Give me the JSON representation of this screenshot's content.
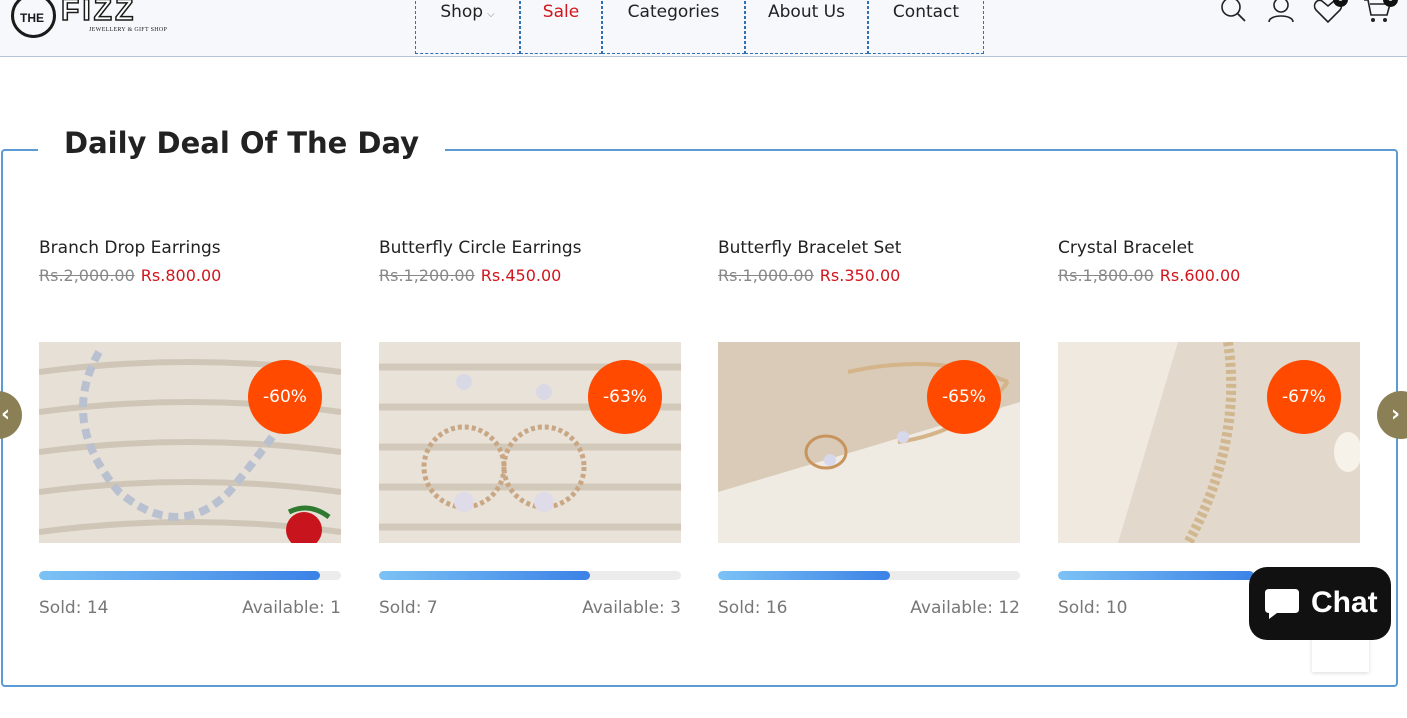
{
  "brand": {
    "logo_prefix": "THE",
    "logo_name": "FIZZ",
    "tagline": "JEWELLERY & GIFT SHOP"
  },
  "nav": {
    "shop": "Shop",
    "sale": "Sale",
    "categories": "Categories",
    "about": "About Us",
    "contact": "Contact"
  },
  "header_icons": [
    "search-icon",
    "account-icon",
    "wishlist-icon",
    "cart-icon"
  ],
  "badges": {
    "wishlist": "0",
    "cart": "0"
  },
  "section": {
    "title": "Daily Deal Of The Day"
  },
  "products": [
    {
      "name": "Branch Drop Earrings",
      "old_price": "Rs.2,000.00",
      "new_price": "Rs.800.00",
      "discount": "-60%",
      "sold": "Sold: 14",
      "available": "Available: 1",
      "progress": 0.93
    },
    {
      "name": "Butterfly Circle Earrings",
      "old_price": "Rs.1,200.00",
      "new_price": "Rs.450.00",
      "discount": "-63%",
      "sold": "Sold: 7",
      "available": "Available: 3",
      "progress": 0.7
    },
    {
      "name": "Butterfly Bracelet Set",
      "old_price": "Rs.1,000.00",
      "new_price": "Rs.350.00",
      "discount": "-65%",
      "sold": "Sold: 16",
      "available": "Available: 12",
      "progress": 0.57
    },
    {
      "name": "Crystal Bracelet",
      "old_price": "Rs.1,800.00",
      "new_price": "Rs.600.00",
      "discount": "-67%",
      "sold": "Sold: 10",
      "available": "",
      "progress": 0.65
    }
  ],
  "carousel": {
    "prev": "‹",
    "next": "›"
  },
  "chat": {
    "label": "Chat"
  },
  "colors": {
    "accent": "#5b9bd5",
    "sale_red": "#d0161d",
    "discount_orange": "#ff4a00",
    "arrow_olive": "#8b8055"
  }
}
